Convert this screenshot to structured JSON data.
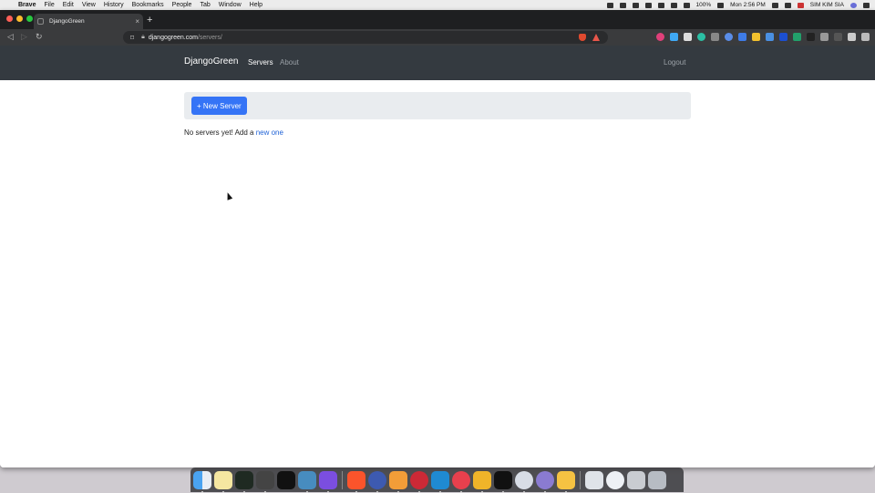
{
  "menubar": {
    "app_name": "Brave",
    "items": [
      "File",
      "Edit",
      "View",
      "History",
      "Bookmarks",
      "People",
      "Tab",
      "Window",
      "Help"
    ],
    "battery": "100%",
    "clock": "Mon 2:56 PM",
    "user": "SIM KIM SIA"
  },
  "browser": {
    "tab_title": "DjangoGreen",
    "tab_close": "×",
    "new_tab": "+",
    "url_host": "djangogreen.com",
    "url_path": "/servers/"
  },
  "site": {
    "brand": "DjangoGreen",
    "nav": {
      "servers": "Servers",
      "about": "About",
      "logout": "Logout"
    },
    "new_server_button": "+ New Server",
    "empty_text": "No servers yet! Add a ",
    "empty_link": "new one"
  },
  "colors": {
    "navbar_bg": "#343a40",
    "primary_button": "#3574f6",
    "link": "#1f62d6",
    "jumbotron_bg": "#e9ecef"
  }
}
